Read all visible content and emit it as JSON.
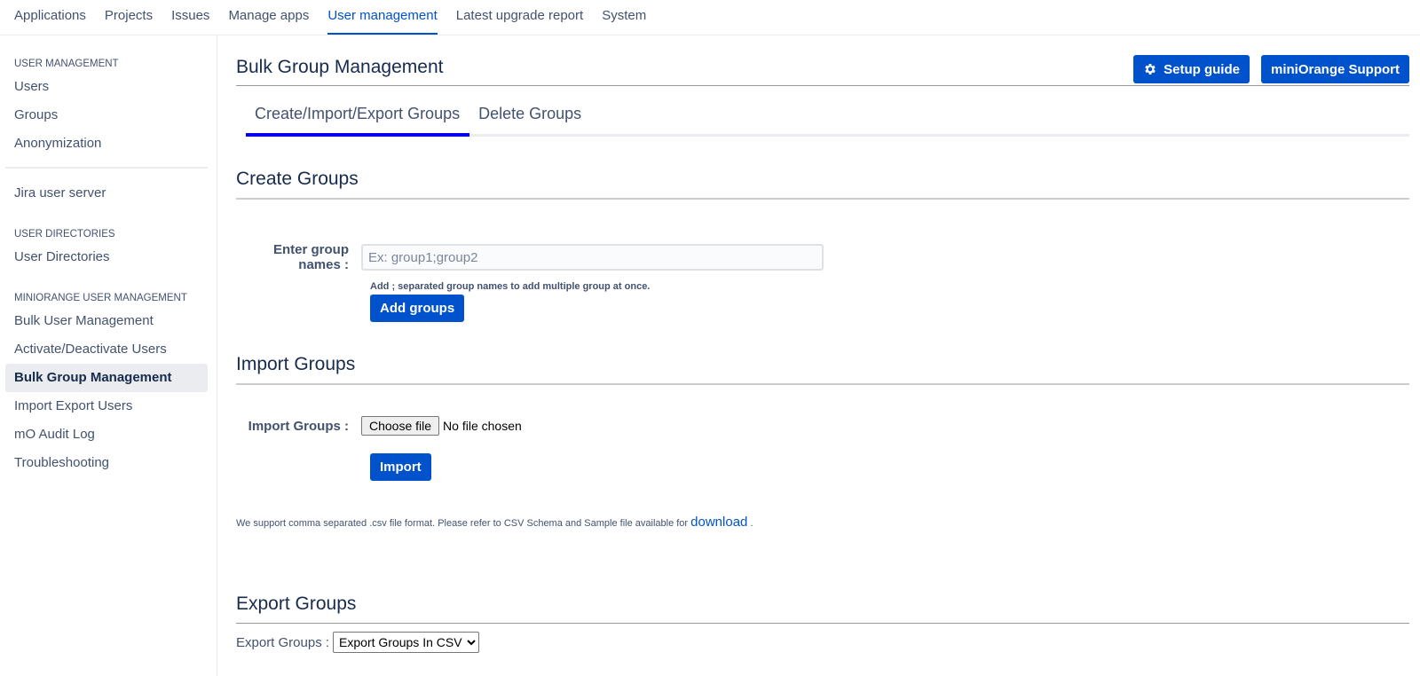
{
  "topnav": {
    "items": [
      {
        "label": "Applications",
        "active": false
      },
      {
        "label": "Projects",
        "active": false
      },
      {
        "label": "Issues",
        "active": false
      },
      {
        "label": "Manage apps",
        "active": false
      },
      {
        "label": "User management",
        "active": true
      },
      {
        "label": "Latest upgrade report",
        "active": false
      },
      {
        "label": "System",
        "active": false
      }
    ]
  },
  "sidebar": {
    "heading_user_management": "USER MANAGEMENT",
    "users": "Users",
    "groups": "Groups",
    "anonymization": "Anonymization",
    "jira_user_server": "Jira user server",
    "heading_user_directories": "USER DIRECTORIES",
    "user_directories": "User Directories",
    "heading_miniorange": "MINIORANGE USER MANAGEMENT",
    "bulk_user_management": "Bulk User Management",
    "activate_deactivate_users": "Activate/Deactivate Users",
    "bulk_group_management": "Bulk Group Management",
    "import_export_users": "Import Export Users",
    "mo_audit_log": "mO Audit Log",
    "troubleshooting": "Troubleshooting"
  },
  "header": {
    "title": "Bulk Group Management",
    "setup_guide": "Setup guide",
    "support": "miniOrange Support"
  },
  "tabs": {
    "create_import_export": "Create/Import/Export Groups",
    "delete": "Delete Groups"
  },
  "create": {
    "title": "Create Groups",
    "label": "Enter group names :",
    "placeholder": "Ex: group1;group2",
    "value": "",
    "hint": "Add ; separated group names to add multiple group at once.",
    "button": "Add groups"
  },
  "import": {
    "title": "Import Groups",
    "label": "Import Groups :",
    "choose_file": "Choose file",
    "file_status": "No file chosen",
    "button": "Import",
    "note": "We support comma separated .csv file format. Please refer to CSV Schema and Sample file available for",
    "download_link": "download",
    "note_end": "."
  },
  "export": {
    "title": "Export Groups",
    "label": "Export Groups :",
    "selected": "Export Groups In CSV"
  },
  "colors": {
    "primary": "#0052cc",
    "active_tab_underline": "#0000ee",
    "text": "#172b4d",
    "muted": "#42526e"
  }
}
